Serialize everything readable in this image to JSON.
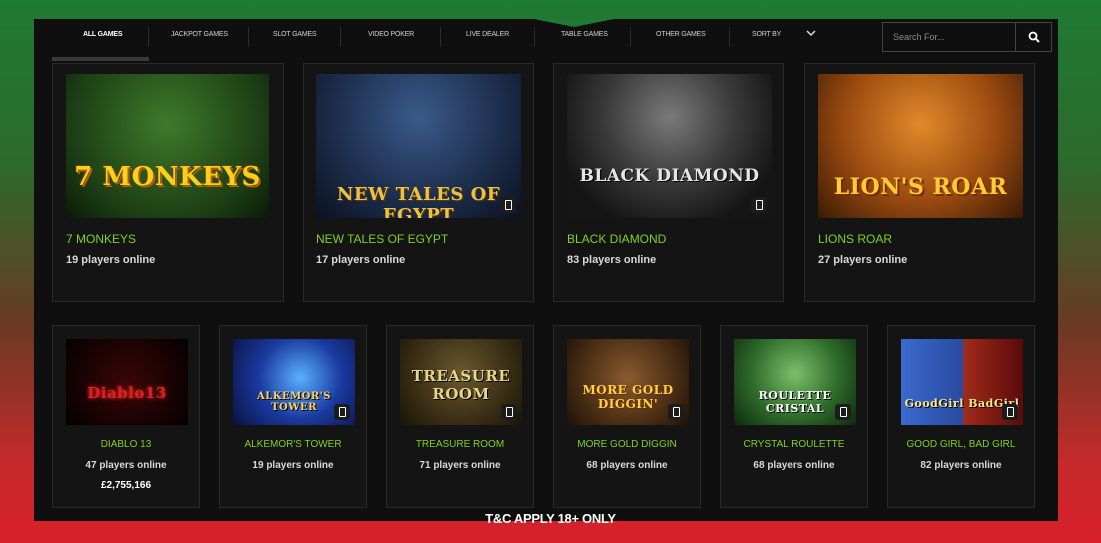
{
  "nav": {
    "items": [
      {
        "label": "ALL GAMES",
        "active": true
      },
      {
        "label": "JACKPOT GAMES"
      },
      {
        "label": "SLOT GAMES"
      },
      {
        "label": "VIDEO POKER"
      },
      {
        "label": "LIVE DEALER"
      },
      {
        "label": "TABLE GAMES"
      },
      {
        "label": "OTHER GAMES"
      },
      {
        "label": "SORT BY"
      }
    ]
  },
  "search": {
    "placeholder": "Search For..."
  },
  "featured": [
    {
      "thumb_text": "7 MONKEYS",
      "name": "7 MONKEYS",
      "players": "19 players online"
    },
    {
      "thumb_text": "NEW TALES OF EGYPT",
      "name": "NEW TALES OF EGYPT",
      "players": "17 players online"
    },
    {
      "thumb_text": "BLACK DIAMOND",
      "name": "BLACK DIAMOND",
      "players": "83 players online"
    },
    {
      "thumb_text": "LION'S ROAR",
      "name": "LIONS ROAR",
      "players": "27 players online"
    }
  ],
  "games": [
    {
      "thumb_text": "Diablo13",
      "name": "DIABLO 13",
      "players": "47 players online",
      "jackpot": "£2,755,166"
    },
    {
      "thumb_text": "ALKEMOR'S TOWER",
      "name": "ALKEMOR'S TOWER",
      "players": "19 players online"
    },
    {
      "thumb_text": "TREASURE ROOM",
      "name": "TREASURE ROOM",
      "players": "71 players online"
    },
    {
      "thumb_text": "MORE GOLD DIGGIN'",
      "name": "MORE GOLD DIGGIN",
      "players": "68 players online"
    },
    {
      "thumb_text": "ROULETTE CRISTAL",
      "name": "CRYSTAL ROULETTE",
      "players": "68 players online"
    },
    {
      "thumb_text": "GoodGirl BadGirl",
      "name": "GOOD GIRL, BAD GIRL",
      "players": "82 players online"
    }
  ],
  "footer": {
    "text": "T&C APPLY 18+ ONLY"
  },
  "colors": {
    "accent_green": "#7ed321",
    "panel": "#0f0f0f",
    "card": "#141414"
  }
}
